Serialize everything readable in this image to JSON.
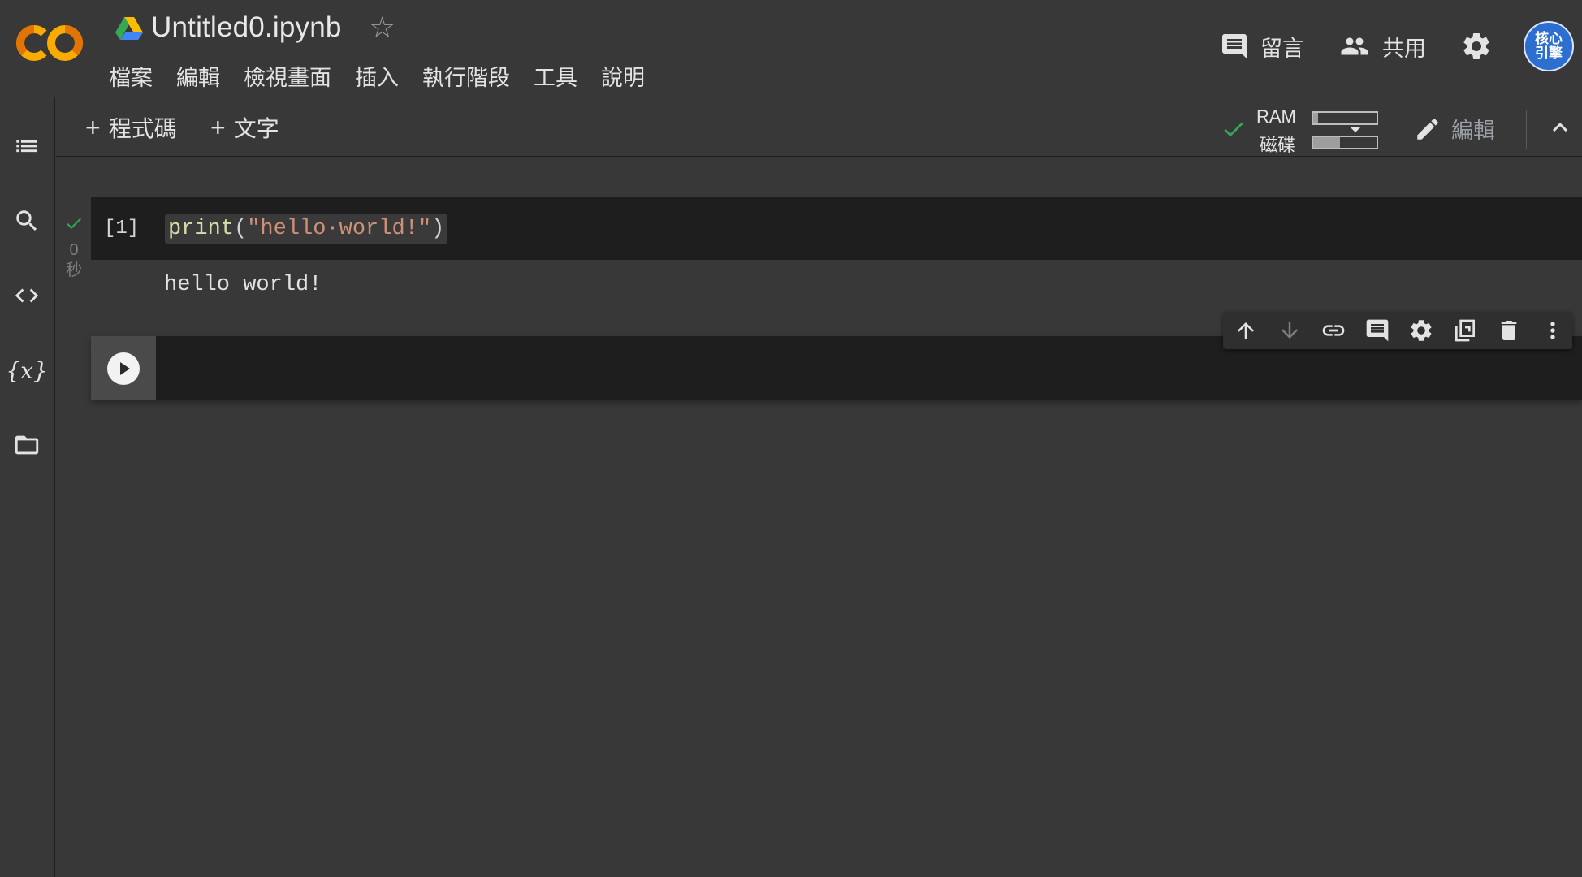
{
  "header": {
    "notebook_title": "Untitled0.ipynb",
    "menu": [
      "檔案",
      "編輯",
      "檢視畫面",
      "插入",
      "執行階段",
      "工具",
      "說明"
    ],
    "comment_label": "留言",
    "share_label": "共用",
    "avatar_lines": [
      "核心",
      "引擎"
    ]
  },
  "toolbar": {
    "add_code_label": "程式碼",
    "add_text_label": "文字",
    "ram_label": "RAM",
    "disk_label": "磁碟",
    "ram_usage": 0.08,
    "disk_usage": 0.42,
    "edit_label": "編輯"
  },
  "cells": [
    {
      "execution_count": "[1]",
      "status_time": "0",
      "status_unit": "秒",
      "code_fn": "print",
      "code_open": "(",
      "code_str": "\"hello·world!\"",
      "code_close": ")",
      "output": "hello world!"
    },
    {
      "execution_count": "",
      "code": ""
    }
  ],
  "icons": {
    "rail": [
      "table-of-contents-icon",
      "search-icon",
      "code-snippets-icon",
      "variables-icon",
      "files-icon"
    ],
    "cell_toolbar": [
      "move-up-icon",
      "move-down-icon",
      "link-icon",
      "comment-icon",
      "settings-icon",
      "mirror-cell-icon",
      "delete-icon",
      "more-icon"
    ]
  },
  "colors": {
    "background": "#383838",
    "cell_background": "#1e1e1e",
    "success_green": "#34a853",
    "logo_orange": "#f9ab00",
    "avatar_blue": "#2d6fd1"
  }
}
